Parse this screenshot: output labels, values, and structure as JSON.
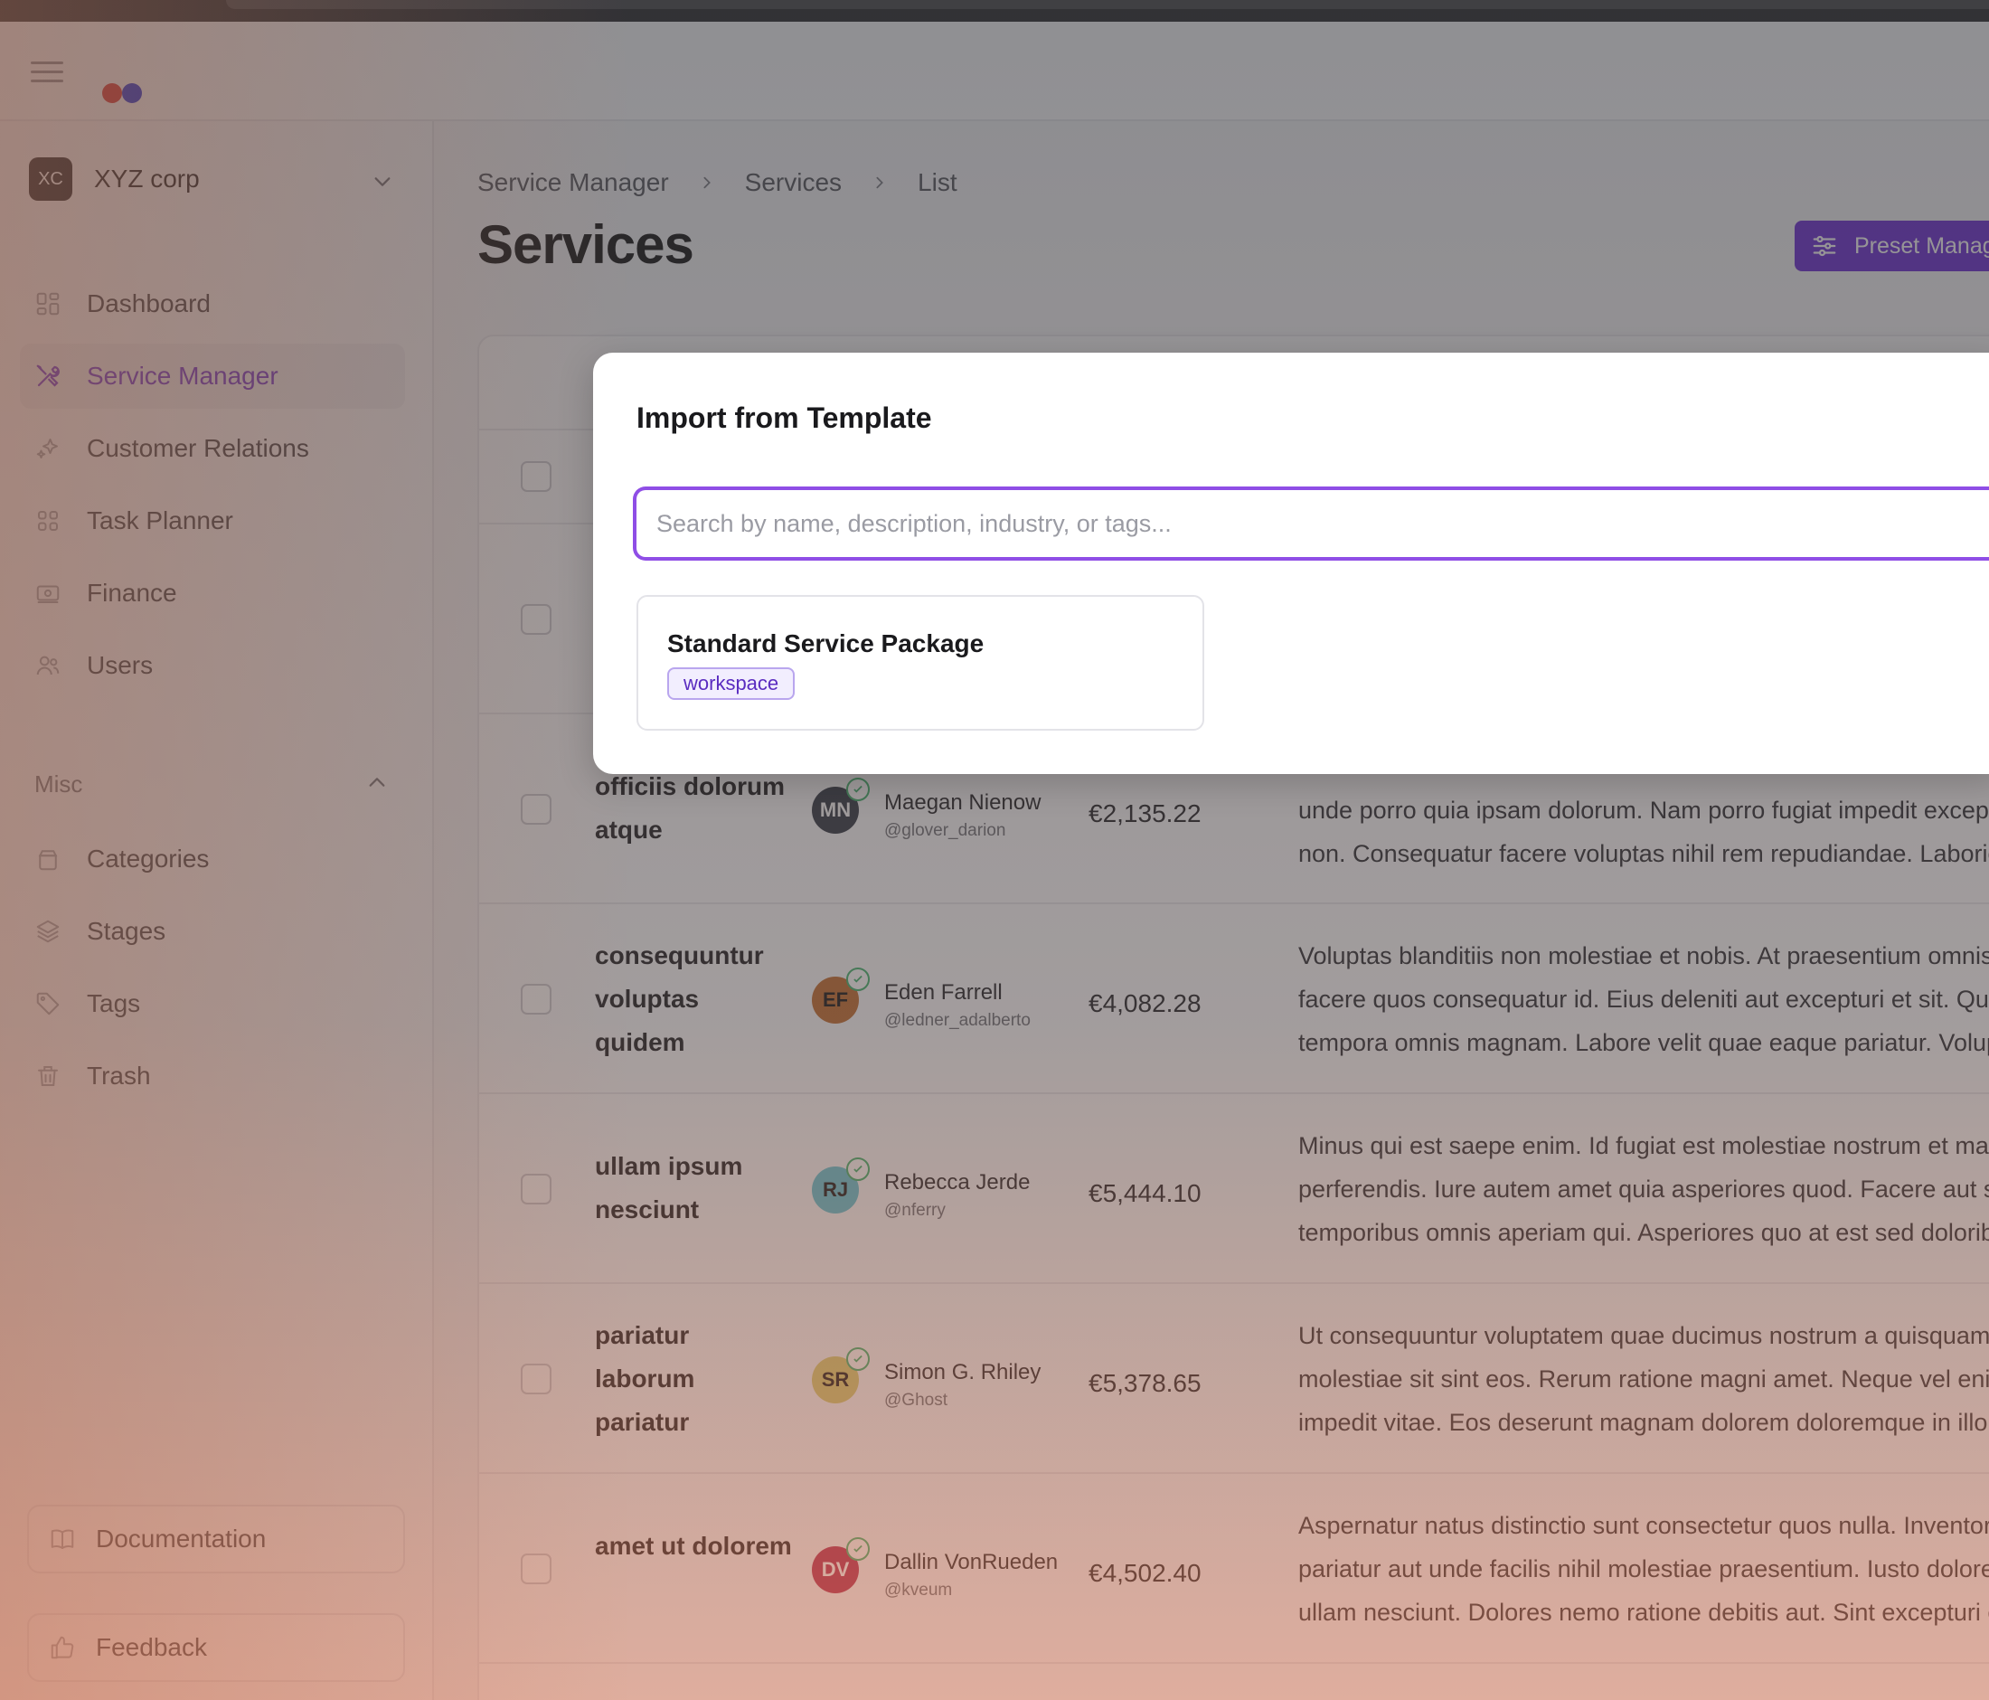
{
  "org": {
    "initials": "XC",
    "name": "XYZ corp"
  },
  "nav": {
    "items": [
      {
        "label": "Dashboard",
        "icon": "grid-icon"
      },
      {
        "label": "Service Manager",
        "icon": "tools-icon",
        "active": true
      },
      {
        "label": "Customer Relations",
        "icon": "sparkles-icon"
      },
      {
        "label": "Task Planner",
        "icon": "grid-dots-icon"
      },
      {
        "label": "Finance",
        "icon": "cash-icon"
      },
      {
        "label": "Users",
        "icon": "users-icon"
      }
    ],
    "misc_label": "Misc",
    "misc_items": [
      {
        "label": "Categories",
        "icon": "archive-icon"
      },
      {
        "label": "Stages",
        "icon": "layers-icon"
      },
      {
        "label": "Tags",
        "icon": "tag-icon"
      },
      {
        "label": "Trash",
        "icon": "trash-icon"
      }
    ],
    "documentation": "Documentation",
    "feedback": "Feedback"
  },
  "breadcrumb": [
    "Service Manager",
    "Services",
    "List"
  ],
  "page": {
    "title": "Services",
    "preset_button": "Preset Manag"
  },
  "rows": [
    {
      "name": "officiis dolorum atque",
      "initials": "MN",
      "avatar_color": "#2d3440",
      "initials_color": "#ffffff",
      "owner": "Maegan Nienow",
      "handle": "@glover_darion",
      "price": "€2,135.22",
      "desc": [
        "unde porro quia ipsam dolorum. Nam porro fugiat impedit exceptu",
        "non. Consequatur facere voluptas nihil rem repudiandae. Laborios"
      ]
    },
    {
      "name": "consequuntur voluptas quidem",
      "initials": "EF",
      "avatar_color": "#c0692a",
      "initials_color": "#1a1a1d",
      "owner": "Eden Farrell",
      "handle": "@ledner_adalberto",
      "price": "€4,082.28",
      "desc": [
        "Voluptas blanditiis non molestiae et nobis. At praesentium omnis qu",
        "facere quos consequatur id. Eius deleniti aut excepturi et sit. Qui ec",
        "tempora omnis magnam. Labore velit quae eaque pariatur. Volupt"
      ]
    },
    {
      "name": "ullam ipsum nesciunt",
      "initials": "RJ",
      "avatar_color": "#5fc3d3",
      "initials_color": "#1a1a1d",
      "owner": "Rebecca Jerde",
      "handle": "@nferry",
      "price": "€5,444.10",
      "desc": [
        "Minus qui est saepe enim. Id fugiat est molestiae nostrum et magni",
        "perferendis. Iure autem amet quia asperiores quod. Facere aut sus",
        "temporibus omnis aperiam qui. Asperiores quo at est sed doloribus"
      ]
    },
    {
      "name": "pariatur laborum pariatur",
      "initials": "SR",
      "avatar_color": "#d9cc6a",
      "initials_color": "#1a1a1d",
      "owner": "Simon G. Rhiley",
      "handle": "@Ghost",
      "price": "€5,378.65",
      "desc": [
        "Ut consequuntur voluptatem quae ducimus nostrum a quisquam. E",
        "molestiae sit sint eos. Rerum ratione magni amet. Neque vel enim e",
        "impedit vitae. Eos deserunt magnam dolorem doloremque in illo..."
      ]
    },
    {
      "name": "amet ut dolorem",
      "initials": "DV",
      "avatar_color": "#b5224a",
      "initials_color": "#ffffff",
      "owner": "Dallin VonRueden",
      "handle": "@kveum",
      "price": "€4,502.40",
      "desc": [
        "Aspernatur natus distinctio sunt consectetur quos nulla. Inventore",
        "pariatur aut unde facilis nihil molestiae praesentium. Iusto dolorem",
        "ullam nesciunt. Dolores nemo ratione debitis aut. Sint excepturi ear"
      ]
    }
  ],
  "modal": {
    "title": "Import from Template",
    "search_placeholder": "Search by name, description, industry, or tags...",
    "templates": [
      {
        "name": "Standard Service Package",
        "tag": "workspace"
      }
    ]
  },
  "colors": {
    "accent": "#6b2cd4",
    "focus_ring": "#8f4ee6",
    "tag_text": "#5a2cc0"
  }
}
